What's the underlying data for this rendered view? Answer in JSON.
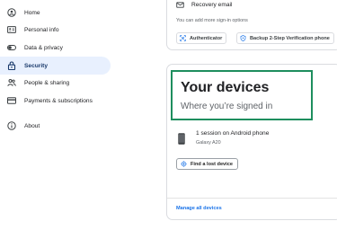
{
  "sidebar": {
    "items": [
      {
        "label": "Home",
        "icon": "home-icon"
      },
      {
        "label": "Personal info",
        "icon": "id-card-icon"
      },
      {
        "label": "Data & privacy",
        "icon": "toggle-icon"
      },
      {
        "label": "Security",
        "icon": "lock-icon",
        "active": true
      },
      {
        "label": "People & sharing",
        "icon": "people-icon"
      },
      {
        "label": "Payments & subscriptions",
        "icon": "card-icon"
      },
      {
        "label": "About",
        "icon": "info-icon"
      }
    ]
  },
  "signin": {
    "recovery_email": "Recovery email",
    "add_more_text": "You can add more sign-in options",
    "chips": [
      {
        "label": "Authenticator",
        "icon": "authenticator-icon"
      },
      {
        "label": "Backup 2-Step Verification phone",
        "icon": "shield-icon"
      }
    ]
  },
  "devices": {
    "title": "Your devices",
    "subtitle": "Where you’re signed in",
    "session_text": "1 session on Android phone",
    "device_name": "Galaxy A20",
    "find_button": "Find a lost device",
    "manage_link": "Manage all devices"
  },
  "colors": {
    "accent": "#1a73e8",
    "active_nav_bg": "#e8f0fe",
    "highlight_border": "#1e8e5e"
  }
}
